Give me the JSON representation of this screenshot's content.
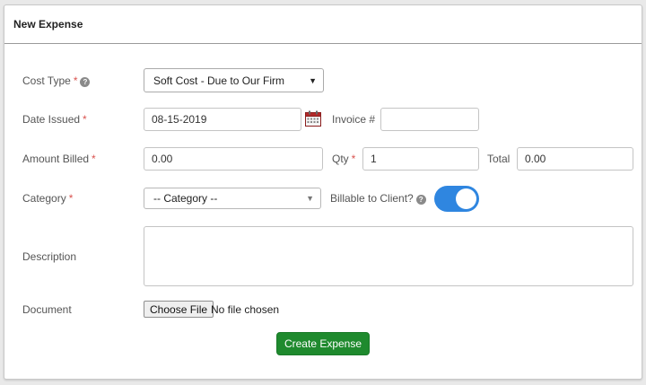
{
  "panel": {
    "title": "New Expense"
  },
  "form": {
    "cost_type": {
      "label": "Cost Type",
      "required": "*",
      "help": "?",
      "selected": "Soft Cost - Due to Our Firm"
    },
    "date_issued": {
      "label": "Date Issued",
      "required": "*",
      "value": "08-15-2019",
      "icon": "calendar-icon"
    },
    "invoice": {
      "label": "Invoice #",
      "value": ""
    },
    "amount_billed": {
      "label": "Amount Billed",
      "required": "*",
      "value": "0.00"
    },
    "qty": {
      "label": "Qty",
      "required": "*",
      "value": "1"
    },
    "total": {
      "label": "Total",
      "value": "0.00"
    },
    "category": {
      "label": "Category",
      "required": "*",
      "selected": "-- Category --"
    },
    "billable": {
      "label": "Billable to Client?",
      "help": "?",
      "on": true,
      "color": "#2f86e0"
    },
    "description": {
      "label": "Description",
      "value": ""
    },
    "document": {
      "label": "Document",
      "button": "Choose File",
      "status": "No file chosen"
    },
    "submit": {
      "label": "Create Expense",
      "color": "#1f8a2e"
    }
  }
}
